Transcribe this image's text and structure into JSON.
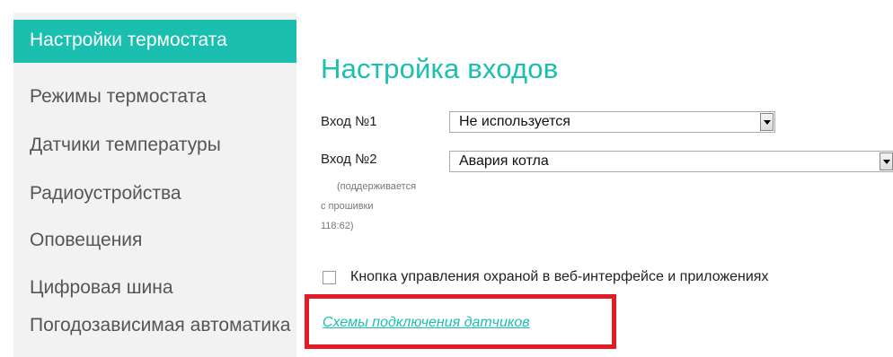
{
  "sidebar": {
    "items": [
      {
        "label": "Настройки термостата",
        "active": true
      },
      {
        "label": "Режимы термостата"
      },
      {
        "label": "Датчики температуры"
      },
      {
        "label": "Радиоустройства"
      },
      {
        "label": "Оповещения"
      },
      {
        "label": "Цифровая шина"
      },
      {
        "label": "Погодозависимая автоматика"
      }
    ]
  },
  "main": {
    "title": "Настройка входов",
    "inputs": [
      {
        "label": "Вход №1",
        "value": "Не используется"
      },
      {
        "label": "Вход №2",
        "value": "Авария котла"
      }
    ],
    "note": {
      "line1": "(поддерживается",
      "line2": "с прошивки",
      "line3": "118:62)"
    },
    "checkbox": {
      "label": "Кнопка управления охраной в веб-интерфейсе и приложениях",
      "checked": false
    },
    "link": "Схемы подключения датчиков"
  },
  "colors": {
    "accent": "#1bbfb0",
    "highlight": "#e31b23",
    "sidebar_bg": "#f2f2f2"
  }
}
